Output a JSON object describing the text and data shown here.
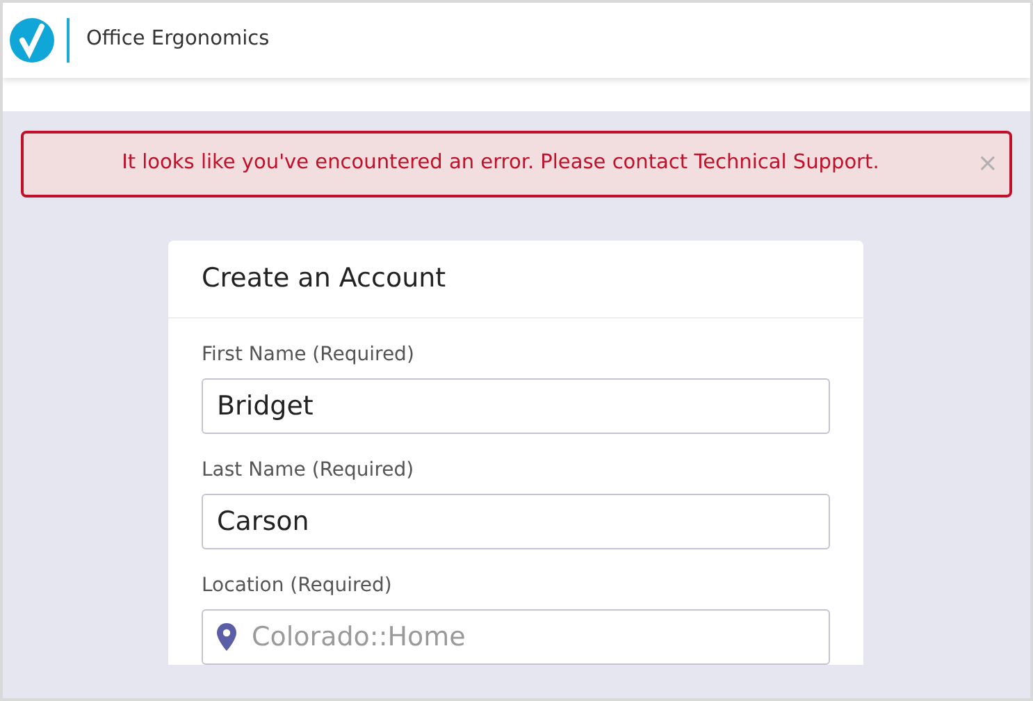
{
  "header": {
    "title": "Office Ergonomics"
  },
  "alert": {
    "message": "It looks like you've encountered an error. Please contact Technical Support.",
    "close": "×"
  },
  "card": {
    "title": "Create an Account",
    "fields": [
      {
        "kind": "text",
        "label": "First Name (Required)",
        "value": "Bridget"
      },
      {
        "kind": "text",
        "label": "Last Name (Required)",
        "value": "Carson"
      },
      {
        "kind": "location",
        "label": "Location (Required)",
        "placeholder": "Colorado::Home"
      }
    ]
  }
}
